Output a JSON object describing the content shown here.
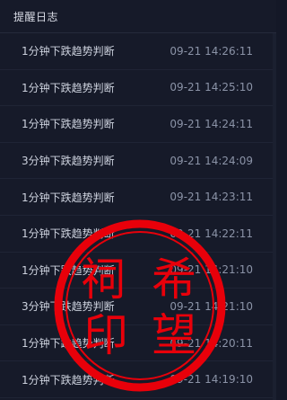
{
  "header": {
    "title": "提醒日志"
  },
  "logs": [
    {
      "message": "1分钟下跌趋势判断",
      "time": "09-21 14:26:11"
    },
    {
      "message": "1分钟下跌趋势判断",
      "time": "09-21 14:25:10"
    },
    {
      "message": "1分钟下跌趋势判断",
      "time": "09-21 14:24:11"
    },
    {
      "message": "3分钟下跌趋势判断",
      "time": "09-21 14:24:09"
    },
    {
      "message": "1分钟下跌趋势判断",
      "time": "09-21 14:23:11"
    },
    {
      "message": "1分钟下跌趋势判断",
      "time": "09-21 14:22:11"
    },
    {
      "message": "1分钟下跌趋势判断",
      "time": "09-21 14:21:10"
    },
    {
      "message": "3分钟下跌趋势判断",
      "time": "09-21 14:21:10"
    },
    {
      "message": "1分钟下跌趋势判断",
      "time": "09-21 14:20:11"
    },
    {
      "message": "1分钟下跌趋势判断",
      "time": "09-21 14:19:10"
    }
  ],
  "seal": {
    "chars": [
      "祠",
      "希",
      "印",
      "望"
    ],
    "color": "#e8000a"
  }
}
